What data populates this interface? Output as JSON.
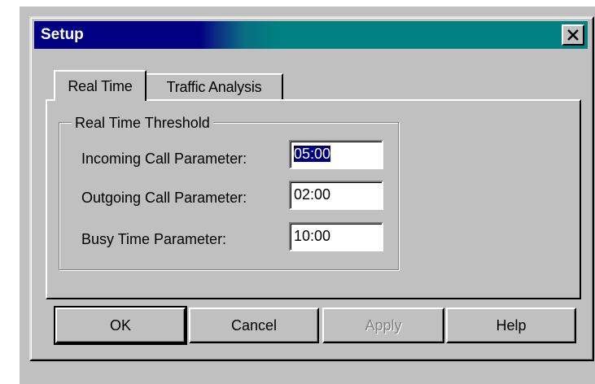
{
  "window": {
    "title": "Setup",
    "close_icon": "close-x-icon",
    "colors": {
      "titlebar_start": "#000080",
      "titlebar_end": "#008080",
      "face": "#c0c0c0"
    }
  },
  "tabs": [
    {
      "label": "Real Time",
      "active": true
    },
    {
      "label": "Traffic Analysis",
      "active": false
    }
  ],
  "group": {
    "title": "Real Time Threshold",
    "fields": [
      {
        "label": "Incoming Call Parameter:",
        "value": "05:00",
        "selected": true
      },
      {
        "label": "Outgoing Call Parameter:",
        "value": "02:00",
        "selected": false
      },
      {
        "label": "Busy Time Parameter:",
        "value": "10:00",
        "selected": false
      }
    ]
  },
  "buttons": {
    "ok": "OK",
    "cancel": "Cancel",
    "apply": "Apply",
    "help": "Help"
  }
}
